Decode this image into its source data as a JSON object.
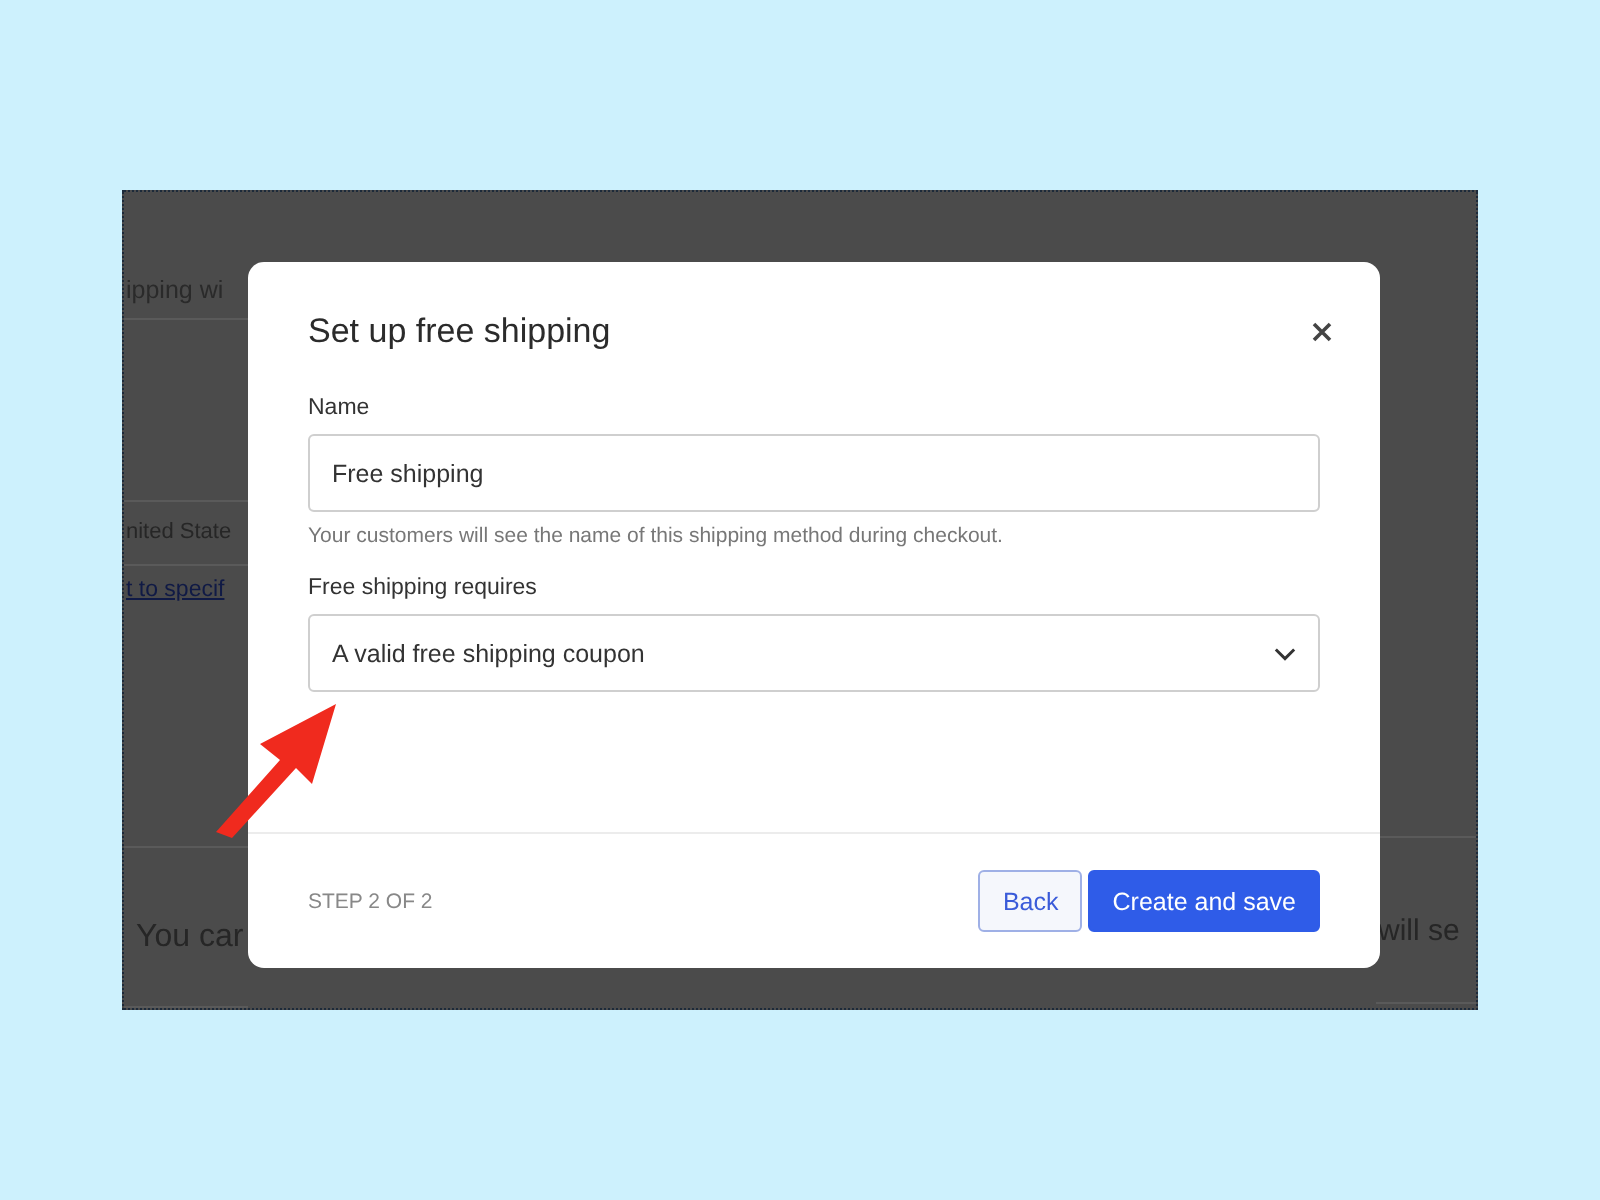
{
  "background_page": {
    "heading": "ipping wi",
    "country": "nited State",
    "link": "t to specif",
    "notice_left": "You car",
    "notice_right": "will se"
  },
  "modal": {
    "title": "Set up free shipping",
    "fields": [
      {
        "kind": "text",
        "label": "Name",
        "value": "Free shipping",
        "help": "Your customers will see the name of this shipping method during checkout."
      },
      {
        "kind": "select",
        "label": "Free shipping requires",
        "value": "A valid free shipping coupon"
      }
    ],
    "step": "STEP 2 OF 2",
    "buttons": [
      {
        "kind": "secondary",
        "label": "Back"
      },
      {
        "kind": "primary",
        "label": "Create and save"
      }
    ]
  }
}
